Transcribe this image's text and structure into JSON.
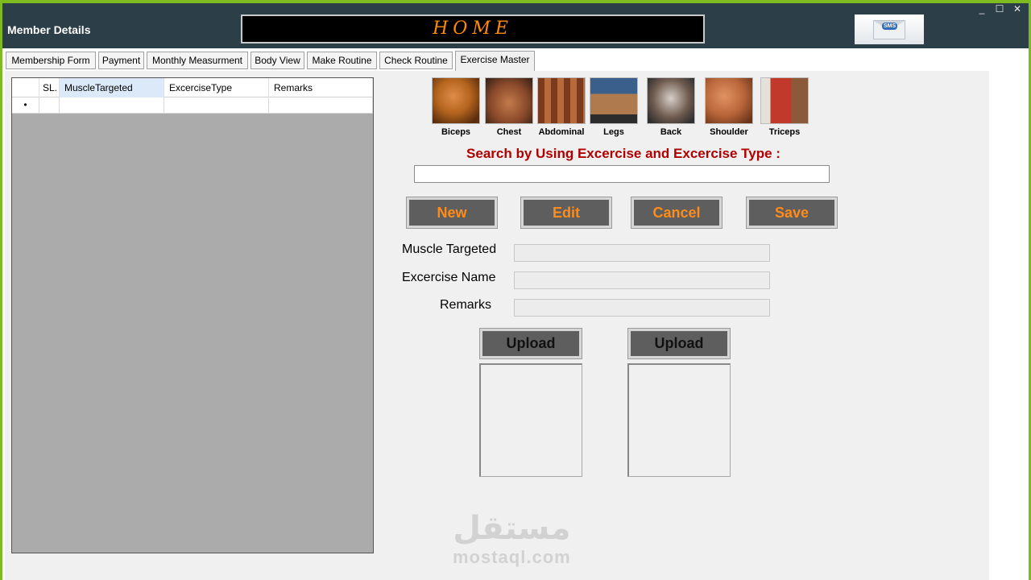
{
  "window": {
    "title": "Member Details",
    "banner": "HOME",
    "logo_text": "SMS",
    "controls": {
      "minimize": "_",
      "maximize": "☐",
      "close": "✕"
    }
  },
  "tabs": [
    {
      "label": "Membership Form"
    },
    {
      "label": "Payment"
    },
    {
      "label": "Monthly Measurment"
    },
    {
      "label": "Body View"
    },
    {
      "label": "Make Routine"
    },
    {
      "label": "Check Routine"
    },
    {
      "label": "Exercise Master",
      "active": true
    }
  ],
  "grid": {
    "columns": [
      "SL.",
      "MuscleTargeted",
      "ExcerciseType",
      "Remarks"
    ],
    "selected_column": "MuscleTargeted",
    "new_row_marker": "•"
  },
  "muscles": [
    {
      "label": "Biceps",
      "color": "#b5651d"
    },
    {
      "label": "Chest",
      "color": "#8b4a2b"
    },
    {
      "label": "Abdominal",
      "color": "#a0522d"
    },
    {
      "label": "Legs",
      "color": "#3a5f8a"
    },
    {
      "label": "Back",
      "color": "#6e5a4e"
    },
    {
      "label": "Shoulder",
      "color": "#b9653a"
    },
    {
      "label": "Triceps",
      "color": "#c0392b"
    }
  ],
  "search": {
    "label": "Search by Using Excercise and Excercise Type :",
    "value": ""
  },
  "buttons": {
    "new": "New",
    "edit": "Edit",
    "cancel": "Cancel",
    "save": "Save"
  },
  "form": {
    "muscle_targeted_label": "Muscle Targeted",
    "excercise_name_label": "Excercise Name",
    "remarks_label": "Remarks",
    "muscle_targeted_value": "",
    "excercise_name_value": "",
    "remarks_value": ""
  },
  "upload": {
    "left_label": "Upload",
    "right_label": "Upload"
  },
  "watermark": {
    "arabic": "مستقل",
    "latin": "mostaql.com"
  },
  "colors": {
    "accent_green": "#7dbb1e",
    "titlebar": "#2c3e48",
    "button_bg": "#5e5e5e",
    "button_text": "#ff8c1a",
    "search_label": "#b00000"
  }
}
